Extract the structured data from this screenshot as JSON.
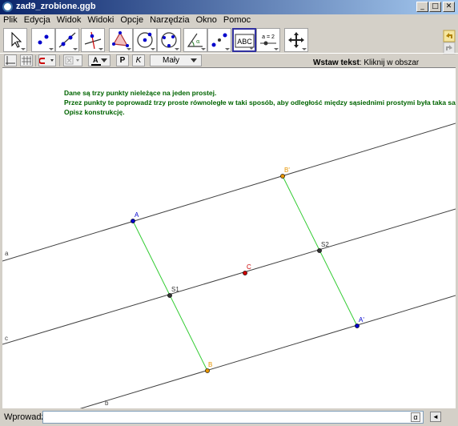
{
  "window": {
    "title": "zad9_zrobione.ggb"
  },
  "menu": [
    "Plik",
    "Edycja",
    "Widok",
    "Widoki",
    "Opcje",
    "Narzędzia",
    "Okno",
    "Pomoc"
  ],
  "toolbar": {
    "help_title": "Wstaw tekst",
    "help_text": ": Kliknij w obszar roboczy lub punkt, aby wprowadzić tekst",
    "text_tool_label": "ABC",
    "slider_tool_label": "a = 2"
  },
  "stylebar": {
    "text_color_label": "A",
    "bold_label": "P",
    "italic_label": "K",
    "font_size_value": "Mały"
  },
  "task": {
    "line1": "Dane są trzy punkty nieleżące na jeden prostej.",
    "line2": "Przez punkty te poprowadź trzy proste równoległe w taki sposób, aby odległość między sąsiednimi prostymi była taka sama.",
    "line3": "Opisz konstrukcję."
  },
  "construction": {
    "lines": [
      "a",
      "c",
      "b"
    ],
    "points": [
      "A",
      "B'",
      "S2",
      "C",
      "S1",
      "A'",
      "B"
    ],
    "colors": {
      "lines": "#404040",
      "perpendicular": "#33cc33",
      "text": "#006400",
      "point_blue": "#0000cc",
      "point_orange": "#e69500",
      "point_red": "#cc0000",
      "point_dark": "#333333"
    }
  },
  "inputbar": {
    "label": "Wprowadź:",
    "value": "",
    "alpha": "α"
  }
}
